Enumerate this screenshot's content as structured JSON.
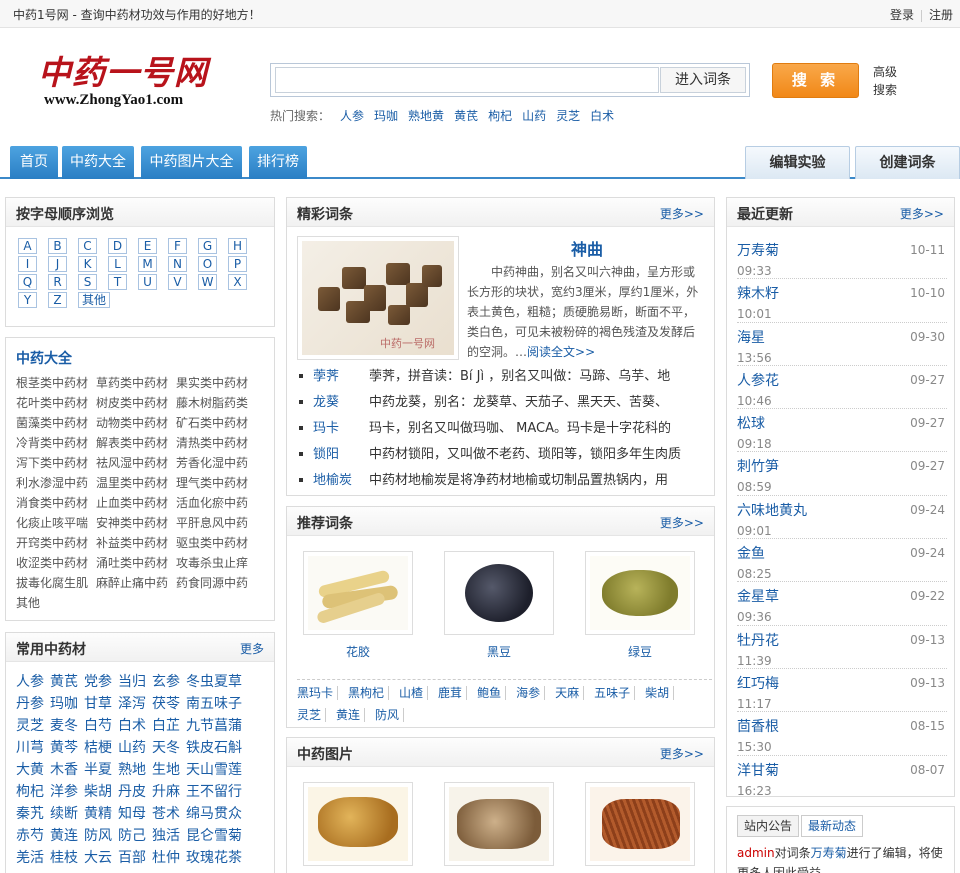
{
  "topbar": {
    "slogan": "中药1号网 - 查询中药材功效与作用的好地方！",
    "login": "登录",
    "register": "注册"
  },
  "logo": {
    "cn": "中药一号网",
    "en": "www.ZhongYao1.com"
  },
  "search": {
    "placeholder": "",
    "type": "进入词条",
    "button": "搜 索",
    "advanced": "高级搜索",
    "hot_label": "热门搜索：",
    "hot": [
      "人参",
      "玛咖",
      "熟地黄",
      "黄芪",
      "枸杞",
      "山药",
      "灵芝",
      "白术"
    ]
  },
  "nav": {
    "tabs": [
      "首页",
      "中药大全",
      "中药图片大全",
      "排行榜"
    ],
    "right": [
      "编辑实验",
      "创建词条"
    ]
  },
  "alpha": {
    "title": "按字母顺序浏览",
    "letters": [
      "A",
      "B",
      "C",
      "D",
      "E",
      "F",
      "G",
      "H",
      "I",
      "J",
      "K",
      "L",
      "M",
      "N",
      "O",
      "P",
      "Q",
      "R",
      "S",
      "T",
      "U",
      "V",
      "W",
      "X",
      "Y",
      "Z"
    ],
    "other": "其他"
  },
  "categories": {
    "title": "中药大全",
    "items": [
      "根茎类中药材",
      "草药类中药材",
      "果实类中药材",
      "花叶类中药材",
      "树皮类中药材",
      "藤木树脂药类",
      "菌藻类中药材",
      "动物类中药材",
      "矿石类中药材",
      "冷背类中药材",
      "解表类中药材",
      "清热类中药材",
      "泻下类中药材",
      "祛风湿中药材",
      "芳香化湿中药",
      "利水渗湿中药",
      "温里类中药材",
      "理气类中药材",
      "消食类中药材",
      "止血类中药材",
      "活血化瘀中药",
      "化痰止咳平喘",
      "安神类中药材",
      "平肝息风中药",
      "开窍类中药材",
      "补益类中药材",
      "驱虫类中药材",
      "收涩类中药材",
      "涌吐类中药材",
      "攻毒杀虫止痒",
      "拔毒化腐生肌",
      "麻醉止痛中药",
      "药食同源中药",
      "其他"
    ]
  },
  "herbs": {
    "title": "常用中药材",
    "more": "更多",
    "items": [
      "人参",
      "黄芪",
      "党参",
      "当归",
      "玄参",
      "冬虫夏草",
      "丹参",
      "玛咖",
      "甘草",
      "泽泻",
      "茯苓",
      "南五味子",
      "灵芝",
      "麦冬",
      "白芍",
      "白术",
      "白芷",
      "九节菖蒲",
      "川芎",
      "黄芩",
      "桔梗",
      "山药",
      "天冬",
      "铁皮石斛",
      "大黄",
      "木香",
      "半夏",
      "熟地",
      "生地",
      "天山雪莲",
      "枸杞",
      "洋参",
      "柴胡",
      "丹皮",
      "升麻",
      "王不留行",
      "秦艽",
      "续断",
      "黄精",
      "知母",
      "苍术",
      "绵马贯众",
      "赤芍",
      "黄连",
      "防风",
      "防己",
      "独活",
      "昆仑雪菊",
      "羌活",
      "桂枝",
      "大云",
      "百部",
      "杜仲",
      "玫瑰花茶"
    ]
  },
  "featured": {
    "title": "精彩词条",
    "more": "更多>>",
    "main_title": "神曲",
    "main_text": "中药神曲，别名又叫六神曲，呈方形或长方形的块状，宽约3厘米，厚约1厘米，外表土黄色，粗糙；质硬脆易断，断面不平，类白色，可见未被粉碎的褐色残渣及发酵后的空洞。…",
    "read_more": "阅读全文>>",
    "list": [
      {
        "name": "荸荠",
        "text": "荸荠，拼音读：Bí Jì ，别名又叫做：马蹄、乌芋、地"
      },
      {
        "name": "龙葵",
        "text": "中药龙葵，别名：龙葵草、天茄子、黑天天、苦葵、"
      },
      {
        "name": "玛卡",
        "text": "玛卡，别名又叫做玛咖、 MACA。玛卡是十字花科的"
      },
      {
        "name": "锁阳",
        "text": "中药材锁阳，又叫做不老药、琐阳等，锁阳多年生肉质"
      },
      {
        "name": "地榆炭",
        "text": "中药材地榆炭是将净药材地榆或切制品置热锅内，用"
      }
    ]
  },
  "recommend": {
    "title": "推荐词条",
    "more": "更多>>",
    "items": [
      "花胶",
      "黑豆",
      "绿豆"
    ],
    "tags": [
      "黑玛卡",
      "黑枸杞",
      "山楂",
      "鹿茸",
      "鲍鱼",
      "海参",
      "天麻",
      "五味子",
      "柴胡",
      "灵芝",
      "黄连",
      "防风"
    ]
  },
  "pictures": {
    "title": "中药图片",
    "more": "更多>>"
  },
  "updates": {
    "title": "最近更新",
    "more": "更多>>",
    "items": [
      {
        "name": "万寿菊",
        "date": "10-11",
        "time": "09:33"
      },
      {
        "name": "辣木籽",
        "date": "10-10",
        "time": "10:01"
      },
      {
        "name": "海星",
        "date": "09-30",
        "time": "13:56"
      },
      {
        "name": "人参花",
        "date": "09-27",
        "time": "10:46"
      },
      {
        "name": "松球",
        "date": "09-27",
        "time": "09:18"
      },
      {
        "name": "刺竹笋",
        "date": "09-27",
        "time": "08:59"
      },
      {
        "name": "六味地黄丸",
        "date": "09-24",
        "time": "09:01"
      },
      {
        "name": "金鱼",
        "date": "09-24",
        "time": "08:25"
      },
      {
        "name": "金星草",
        "date": "09-22",
        "time": "09:36"
      },
      {
        "name": "牡丹花",
        "date": "09-13",
        "time": "11:39"
      },
      {
        "name": "红巧梅",
        "date": "09-13",
        "time": "11:17"
      },
      {
        "name": "茴香根",
        "date": "08-15",
        "time": "15:30"
      },
      {
        "name": "洋甘菊",
        "date": "08-07",
        "time": "16:23"
      }
    ]
  },
  "notice": {
    "tabs": [
      "站内公告",
      "最新动态"
    ],
    "user": "admin",
    "pre": "对词条",
    "entry": "万寿菊",
    "post": "进行了编辑，将使更多人因此受益"
  },
  "colors": {
    "accent": "#1a5da6",
    "nav": "#2a7ec4",
    "search_button": "#f18817",
    "logo_red": "#b8131b"
  }
}
